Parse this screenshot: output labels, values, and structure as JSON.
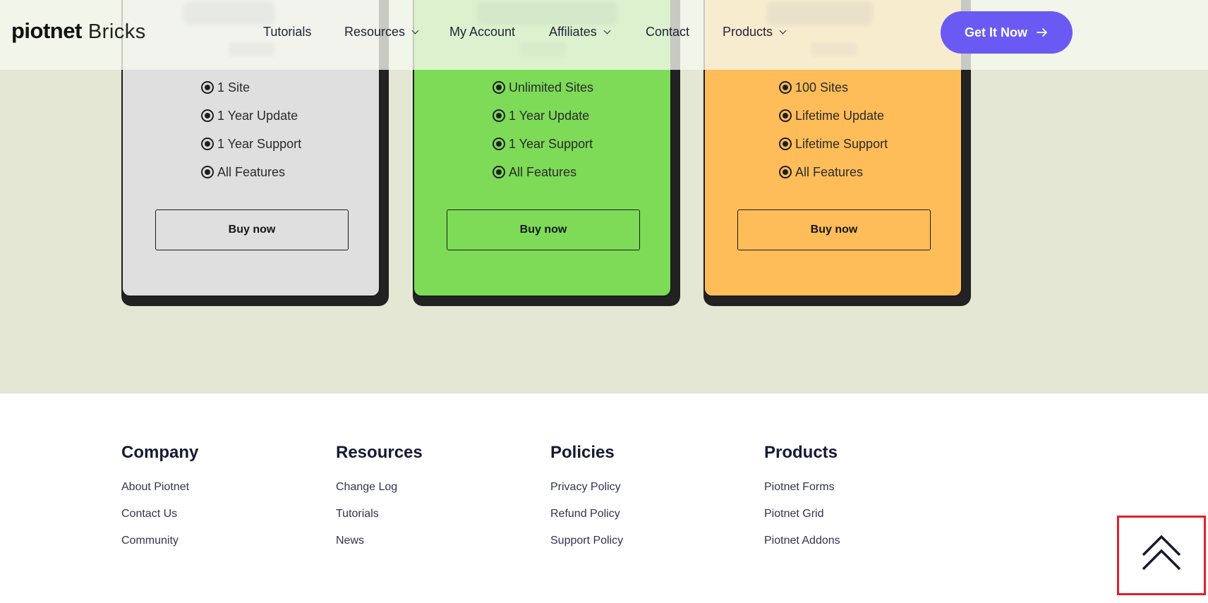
{
  "header": {
    "logo_main": "piotnet",
    "logo_sub": "Bricks",
    "nav": [
      {
        "label": "Tutorials",
        "has_dropdown": false
      },
      {
        "label": "Resources",
        "has_dropdown": true
      },
      {
        "label": "My Account",
        "has_dropdown": false
      },
      {
        "label": "Affiliates",
        "has_dropdown": true
      },
      {
        "label": "Contact",
        "has_dropdown": false
      },
      {
        "label": "Products",
        "has_dropdown": true
      }
    ],
    "cta_label": "Get It Now",
    "cta_color": "#6a5af3"
  },
  "pricing": {
    "plans": [
      {
        "color": "#dfdfdf",
        "features": [
          "1 Site",
          "1 Year Update",
          "1 Year Support",
          "All Features"
        ],
        "button_label": "Buy now"
      },
      {
        "color": "#7edb58",
        "features": [
          "Unlimited Sites",
          "1 Year Update",
          "1 Year Support",
          "All Features"
        ],
        "button_label": "Buy now"
      },
      {
        "color": "#ffbd59",
        "features": [
          "100 Sites",
          "Lifetime Update",
          "Lifetime Support",
          "All Features"
        ],
        "button_label": "Buy now"
      }
    ],
    "background": "#e3e7d3"
  },
  "footer": {
    "columns": [
      {
        "heading": "Company",
        "links": [
          "About Piotnet",
          "Contact Us",
          "Community"
        ]
      },
      {
        "heading": "Resources",
        "links": [
          "Change Log",
          "Tutorials",
          "News"
        ]
      },
      {
        "heading": "Policies",
        "links": [
          "Privacy Policy",
          "Refund Policy",
          "Support Policy"
        ]
      },
      {
        "heading": "Products",
        "links": [
          "Piotnet Forms",
          "Piotnet Grid",
          "Piotnet Addons"
        ]
      }
    ]
  },
  "back_to_top": {
    "icon": "double-chevron-up-icon",
    "highlight_color": "#e0202a"
  }
}
